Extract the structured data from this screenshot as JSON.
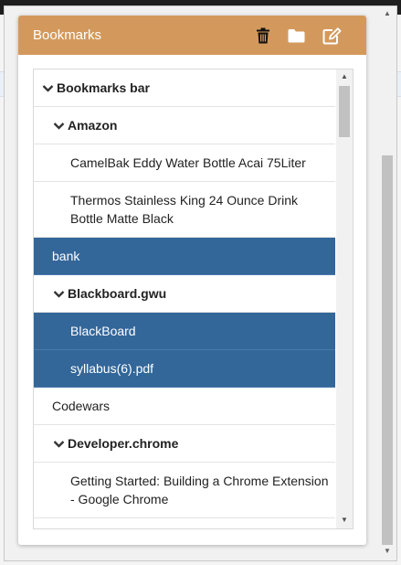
{
  "popup": {
    "title": "Bookmarks",
    "header_color": "#d3995c",
    "selected_color": "#336699",
    "actions": [
      {
        "name": "delete",
        "icon": "trash-icon"
      },
      {
        "name": "new-folder",
        "icon": "folder-icon"
      },
      {
        "name": "edit",
        "icon": "edit-icon"
      }
    ]
  },
  "tree": {
    "items": [
      {
        "label": "Bookmarks bar",
        "type": "folder",
        "level": 0,
        "expanded": true,
        "selected": false
      },
      {
        "label": "Amazon",
        "type": "folder",
        "level": 1,
        "expanded": true,
        "selected": false
      },
      {
        "label": "CamelBak Eddy Water Bottle Acai 75Liter",
        "type": "bookmark",
        "level": 2,
        "selected": false
      },
      {
        "label": "Thermos Stainless King 24 Ounce Drink Bottle Matte Black",
        "type": "bookmark",
        "level": 2,
        "selected": false
      },
      {
        "label": "bank",
        "type": "bookmark",
        "level": 1,
        "selected": true
      },
      {
        "label": "Blackboard.gwu",
        "type": "folder",
        "level": 1,
        "expanded": true,
        "selected": false
      },
      {
        "label": "BlackBoard",
        "type": "bookmark",
        "level": 2,
        "selected": true
      },
      {
        "label": "syllabus(6).pdf",
        "type": "bookmark",
        "level": 2,
        "selected": true
      },
      {
        "label": "Codewars",
        "type": "bookmark",
        "level": 1,
        "selected": false
      },
      {
        "label": "Developer.chrome",
        "type": "folder",
        "level": 1,
        "expanded": true,
        "selected": false
      },
      {
        "label": "Getting Started: Building a Chrome Extension - Google Chrome",
        "type": "bookmark",
        "level": 2,
        "selected": false
      },
      {
        "label": "",
        "type": "bookmark",
        "level": 2,
        "selected": false
      }
    ]
  }
}
